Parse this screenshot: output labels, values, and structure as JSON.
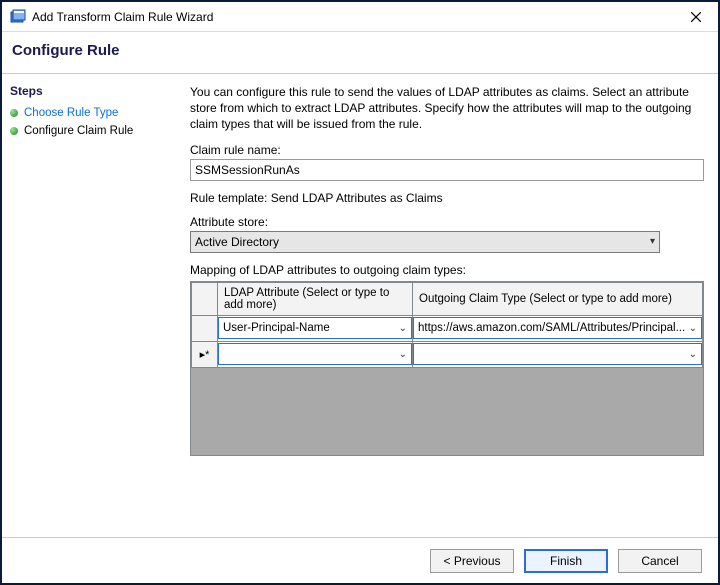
{
  "window": {
    "title": "Add Transform Claim Rule Wizard"
  },
  "header": {
    "title": "Configure Rule"
  },
  "sidebar": {
    "steps_header": "Steps",
    "steps": [
      {
        "label": "Choose Rule Type"
      },
      {
        "label": "Configure Claim Rule"
      }
    ]
  },
  "main": {
    "description": "You can configure this rule to send the values of LDAP attributes as claims. Select an attribute store from which to extract LDAP attributes. Specify how the attributes will map to the outgoing claim types that will be issued from the rule.",
    "claim_rule_label": "Claim rule name:",
    "claim_rule_name": "SSMSessionRunAs",
    "template_label": "Rule template: Send LDAP Attributes as Claims",
    "attribute_store_label": "Attribute store:",
    "attribute_store_value": "Active Directory",
    "mapping_label": "Mapping of LDAP attributes to outgoing claim types:",
    "grid": {
      "col_ldap": "LDAP Attribute (Select or type to add more)",
      "col_claim": "Outgoing Claim Type (Select or type to add more)",
      "rows": [
        {
          "marker": "",
          "ldap": "User-Principal-Name",
          "claim": "https://aws.amazon.com/SAML/Attributes/Principal..."
        },
        {
          "marker": "▸*",
          "ldap": "",
          "claim": ""
        }
      ]
    }
  },
  "footer": {
    "previous": "< Previous",
    "finish": "Finish",
    "cancel": "Cancel"
  }
}
